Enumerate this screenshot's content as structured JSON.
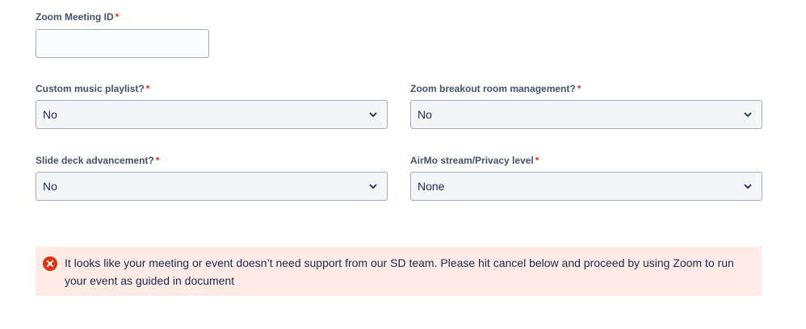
{
  "zoom_meeting_id": {
    "label": "Zoom Meeting ID",
    "required_mark": "*",
    "value": ""
  },
  "custom_music_playlist": {
    "label": "Custom music playlist?",
    "required_mark": "*",
    "value": "No"
  },
  "zoom_breakout_room": {
    "label": "Zoom breakout room management?",
    "required_mark": "*",
    "value": "No"
  },
  "slide_deck_advancement": {
    "label": "Slide deck advancement?",
    "required_mark": "*",
    "value": "No"
  },
  "airmo_stream_privacy": {
    "label": "AirMo stream/Privacy level",
    "required_mark": "*",
    "value": "None"
  },
  "alert": {
    "icon": "error-icon",
    "message": "It looks like your meeting or event doesn’t need support from our SD team. Please hit cancel below and proceed by using Zoom to run your event as guided in document"
  },
  "colors": {
    "required": "#de350b",
    "error": "#de350b",
    "alert_background": "#ffebe6",
    "select_background": "#f4f5f7",
    "border": "#a5adba"
  }
}
